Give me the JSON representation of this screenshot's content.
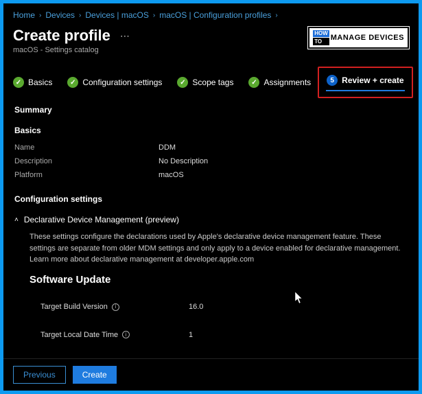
{
  "breadcrumbs": [
    "Home",
    "Devices",
    "Devices | macOS",
    "macOS | Configuration profiles"
  ],
  "header": {
    "title": "Create profile",
    "subtitle": "macOS - Settings catalog",
    "logo_text": "MANAGE DEVICES"
  },
  "steps": [
    {
      "label": "Basics",
      "done": true
    },
    {
      "label": "Configuration settings",
      "done": true
    },
    {
      "label": "Scope tags",
      "done": true
    },
    {
      "label": "Assignments",
      "done": true
    },
    {
      "label": "Review + create",
      "done": false,
      "num": "5"
    }
  ],
  "summary": {
    "title": "Summary",
    "basics_title": "Basics",
    "rows": {
      "name_label": "Name",
      "name_value": "DDM",
      "desc_label": "Description",
      "desc_value": "No Description",
      "platform_label": "Platform",
      "platform_value": "macOS"
    }
  },
  "config": {
    "title": "Configuration settings",
    "accordion_label": "Declarative Device Management (preview)",
    "description": "These settings configure the declarations used by Apple's declarative device management feature. These settings are separate from older MDM settings and only apply to a device enabled for declarative management. Learn more about declarative management at developer.apple.com",
    "sw_title": "Software Update",
    "fields": {
      "tbv_label": "Target Build Version",
      "tbv_value": "16.0",
      "tldt_label": "Target Local Date Time",
      "tldt_value": "1"
    }
  },
  "footer": {
    "previous": "Previous",
    "create": "Create"
  }
}
